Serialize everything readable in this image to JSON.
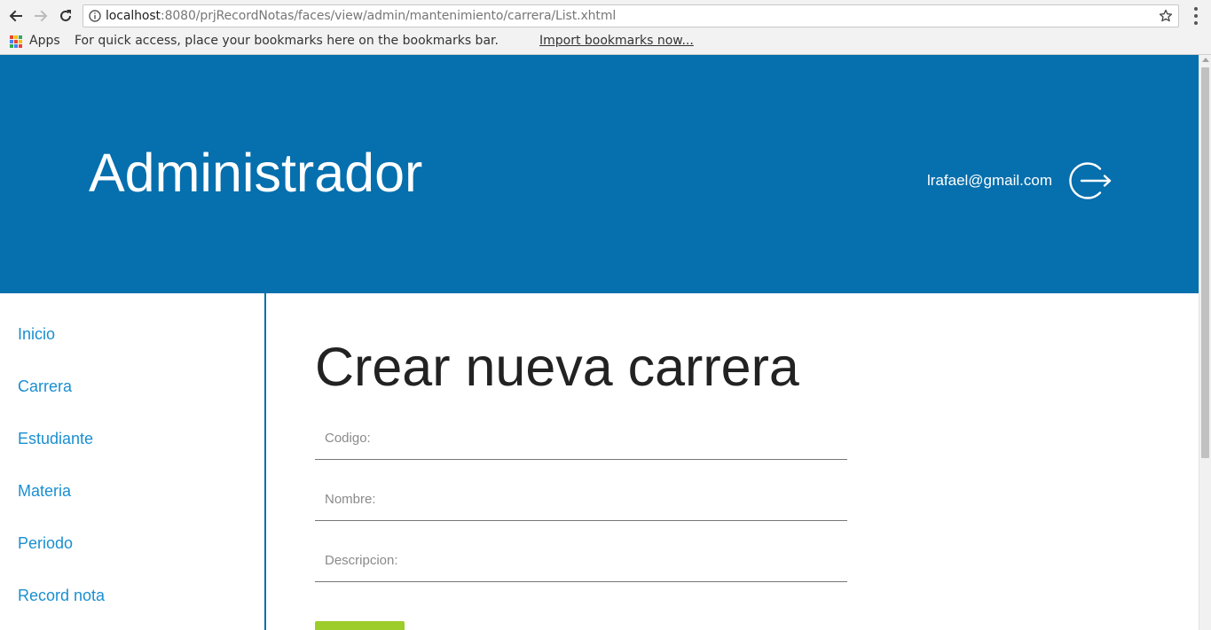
{
  "browser": {
    "url_host": "localhost",
    "url_rest": ":8080/prjRecordNotas/faces/view/admin/mantenimiento/carrera/List.xhtml",
    "icons": [
      "back-arrow-icon",
      "forward-arrow-icon",
      "reload-icon",
      "site-info-icon",
      "bookmark-star-icon",
      "menu-dots-icon"
    ]
  },
  "bookmarks_bar": {
    "apps_label": "Apps",
    "prompt_text": "For quick access, place your bookmarks here on the bookmarks bar.",
    "import_link": "Import bookmarks now..."
  },
  "header": {
    "title": "Administrador",
    "user_email": "lrafael@gmail.com",
    "logout_icon": "logout-icon",
    "background_color": "#066fad"
  },
  "sidebar": {
    "items": [
      {
        "label": "Inicio"
      },
      {
        "label": "Carrera"
      },
      {
        "label": "Estudiante"
      },
      {
        "label": "Materia"
      },
      {
        "label": "Periodo"
      },
      {
        "label": "Record nota"
      }
    ],
    "link_color": "#1a8fd1"
  },
  "main": {
    "title": "Crear nueva carrera",
    "fields": [
      {
        "placeholder": "Codigo:",
        "value": ""
      },
      {
        "placeholder": "Nombre:",
        "value": ""
      },
      {
        "placeholder": "Descripcion:",
        "value": ""
      }
    ],
    "submit_button": {
      "label": "",
      "color": "#9ccd2a"
    }
  }
}
